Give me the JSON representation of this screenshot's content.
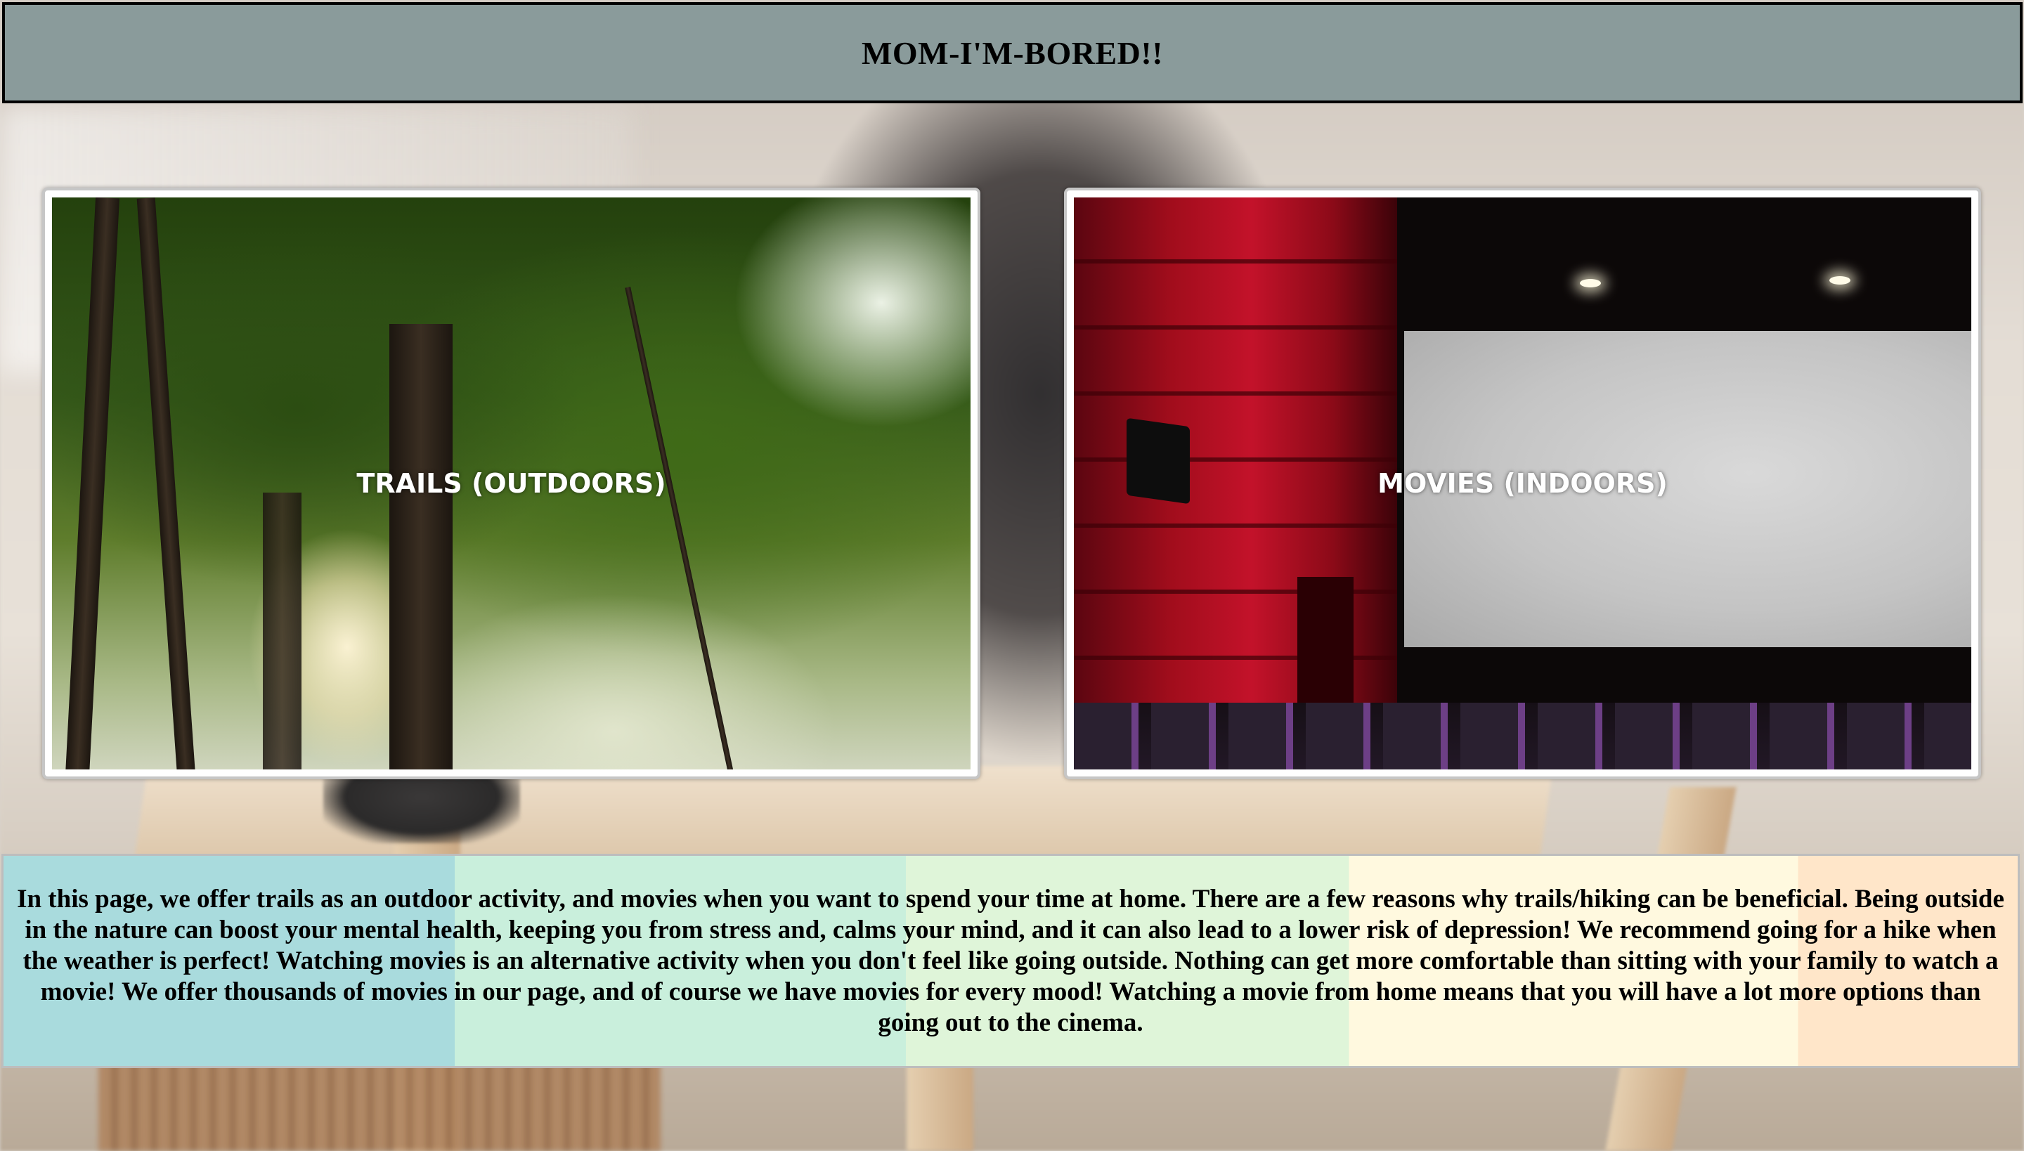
{
  "header": {
    "title": "MOM-I'M-BORED!!"
  },
  "cards": {
    "trails": {
      "label": "TRAILS (OUTDOORS)"
    },
    "movies": {
      "label": "MOVIES (INDOORS)"
    }
  },
  "info": {
    "text": "In this page, we offer trails as an outdoor activity, and movies when you want to spend your time at home. There are a few reasons why trails/hiking can be beneficial. Being outside in the nature can boost your mental health, keeping you from stress and, calms your mind, and it can also lead to a lower risk of depression! We recommend going for a hike when the weather is perfect! Watching movies is an alternative activity when you don't feel like going outside. Nothing can get more comfortable than sitting with your family to watch a movie! We offer thousands of movies in our page, and of course we have movies for every mood! Watching a movie from home means that you will have a lot more options than going out to the cinema."
  },
  "colors": {
    "header_bg": "#8a9b9b",
    "info_bands": [
      "#a9dbdd",
      "#c9efdc",
      "#dff5d9",
      "#fff9df",
      "#ffe6c9"
    ]
  }
}
